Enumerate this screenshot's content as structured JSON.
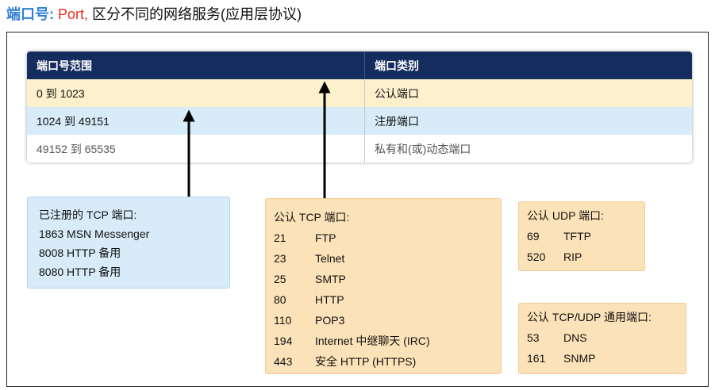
{
  "heading": {
    "term": "端口号:",
    "word": "Port,",
    "rest": "区分不同的网络服务(应用层协议)"
  },
  "table": {
    "headers": [
      "端口号范围",
      "端口类别"
    ],
    "rows": [
      {
        "range": "0 到 1023",
        "category": "公认端口"
      },
      {
        "range": "1024 到 49151",
        "category": "注册端口"
      },
      {
        "range": "49152 到 65535",
        "category": "私有和(或)动态端口"
      }
    ]
  },
  "registered_tcp": {
    "title": "已注册的 TCP 端口:",
    "items": [
      "1863 MSN Messenger",
      "8008 HTTP 备用",
      "8080 HTTP 备用"
    ]
  },
  "wellknown_tcp": {
    "title": "公认 TCP 端口:",
    "items": [
      {
        "port": "21",
        "service": "FTP"
      },
      {
        "port": "23",
        "service": "Telnet"
      },
      {
        "port": "25",
        "service": "SMTP"
      },
      {
        "port": "80",
        "service": "HTTP"
      },
      {
        "port": "110",
        "service": "POP3"
      },
      {
        "port": "194",
        "service": "Internet 中继聊天 (IRC)"
      },
      {
        "port": "443",
        "service": "安全 HTTP (HTTPS)"
      }
    ]
  },
  "wellknown_udp": {
    "title": "公认 UDP 端口:",
    "items": [
      {
        "port": "69",
        "service": "TFTP"
      },
      {
        "port": "520",
        "service": "RIP"
      }
    ]
  },
  "wellknown_tcp_udp": {
    "title": "公认 TCP/UDP 通用端口:",
    "items": [
      {
        "port": "53",
        "service": "DNS"
      },
      {
        "port": "161",
        "service": "SNMP"
      }
    ]
  },
  "colors": {
    "header_bg": "#142c5e",
    "wellknown_bg": "#fdf0cc",
    "registered_bg": "#d8ebf8",
    "box_orange": "#fce2b8",
    "heading_blue": "#2f7fd6",
    "heading_red": "#e8301f"
  }
}
